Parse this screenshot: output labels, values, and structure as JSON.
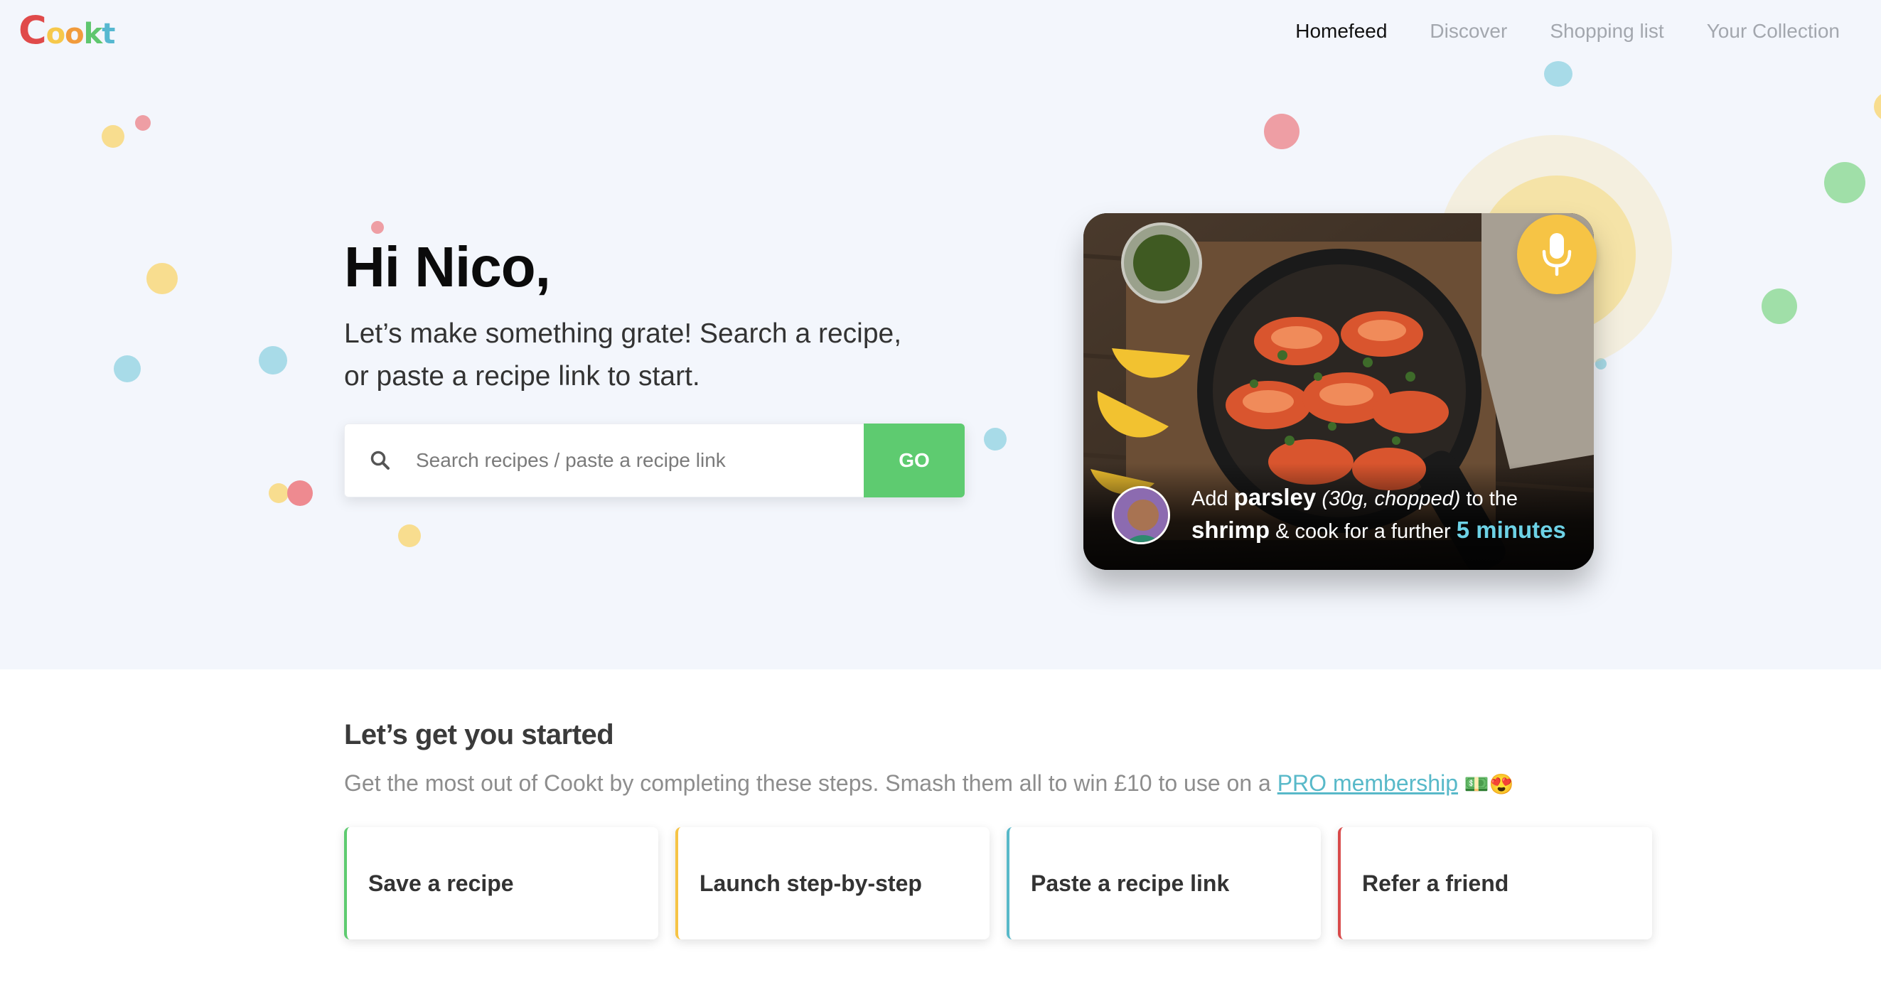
{
  "brand": {
    "logo_text": "Cookt"
  },
  "nav": {
    "items": [
      {
        "label": "Homefeed",
        "active": true
      },
      {
        "label": "Discover",
        "active": false
      },
      {
        "label": "Shopping list",
        "active": false
      },
      {
        "label": "Your Collection",
        "active": false
      }
    ]
  },
  "hero": {
    "greeting": "Hi Nico,",
    "subtitle": "Let’s make something grate! Search a recipe, or paste a recipe link to start.",
    "search": {
      "placeholder": "Search recipes / paste a recipe link",
      "value": "",
      "icon": "search-icon",
      "button_label": "GO"
    },
    "recipe_card": {
      "mic_icon": "microphone-icon",
      "instruction": {
        "prefix": "Add",
        "ingredient": "parsley",
        "detail": "(30g, chopped)",
        "to_the": "to the",
        "target": "shrimp",
        "middle": "& cook for a further",
        "time": "5 minutes"
      }
    }
  },
  "started": {
    "title": "Let’s get you started",
    "description": "Get the most out of Cookt by completing these steps. Smash them all to win £10 to use on a",
    "link_label": "PRO membership",
    "emoji": "💵😍",
    "steps": [
      {
        "label": "Save a recipe",
        "color": "#5ecb70"
      },
      {
        "label": "Launch step-by-step",
        "color": "#f6c445"
      },
      {
        "label": "Paste a recipe link",
        "color": "#58b9c9"
      },
      {
        "label": "Refer a friend",
        "color": "#d84b4b"
      }
    ]
  },
  "colors": {
    "accent_green": "#5ecb70",
    "accent_yellow": "#f6c445",
    "accent_blue": "#58b9c9",
    "accent_red": "#d84b4b",
    "hero_bg": "#f3f6fc"
  }
}
